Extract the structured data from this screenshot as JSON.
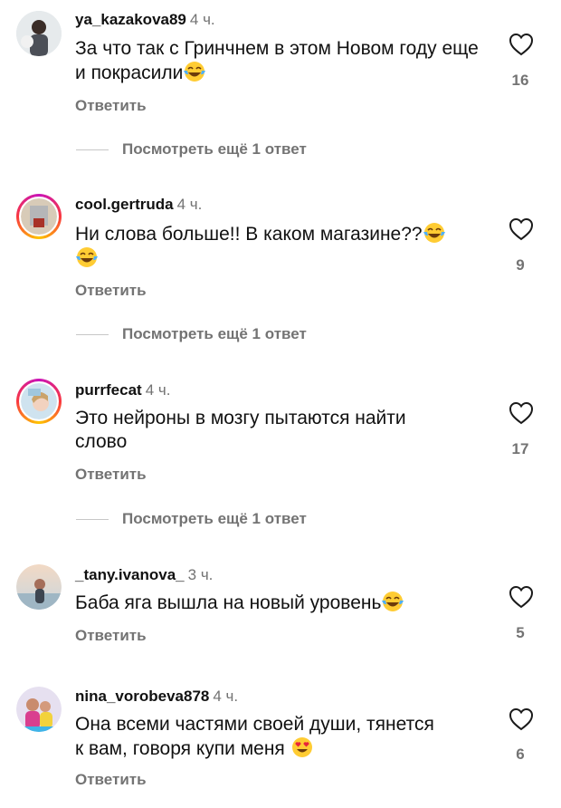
{
  "comments": [
    {
      "username": "ya_kazakova89",
      "time": "4 ч.",
      "text": "За что так с Гринчнем в этом Новом году еще и покрасили",
      "likes": "16",
      "reply_label": "Ответить",
      "more_replies": "Посмотреть ещё 1 ответ",
      "emoji": "face-with-tears-of-joy"
    },
    {
      "username": "cool.gertruda",
      "time": "4 ч.",
      "text": "Ни слова больше!! В каком магазине??",
      "likes": "9",
      "reply_label": "Ответить",
      "more_replies": "Посмотреть ещё 1 ответ",
      "emoji": "face-with-tears-of-joy"
    },
    {
      "username": "purrfecat",
      "time": "4 ч.",
      "text_line1": "Это нейроны в мозгу пытаются найти",
      "text_line2": "слово",
      "likes": "17",
      "reply_label": "Ответить",
      "more_replies": "Посмотреть ещё 1 ответ"
    },
    {
      "username": "_tany.ivanova_",
      "time": "3 ч.",
      "text": "Баба яга вышла на новый уровень",
      "likes": "5",
      "reply_label": "Ответить",
      "emoji": "face-with-tears-of-joy"
    },
    {
      "username": "nina_vorobeva878",
      "time": "4 ч.",
      "text_line1": "Она всеми частями своей души, тянется",
      "text_line2": "к вам, говоря купи меня",
      "likes": "6",
      "reply_label": "Ответить",
      "emoji": "smiling-face-with-heart-eyes"
    }
  ],
  "icons": {
    "like": "heart-outline-icon"
  },
  "colors": {
    "secondary_text": "#737373",
    "primary_text": "#111111",
    "story_ring": "#c913b9"
  }
}
